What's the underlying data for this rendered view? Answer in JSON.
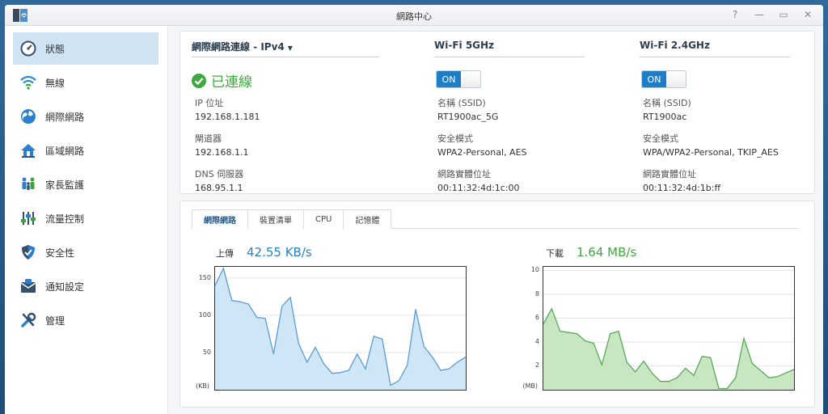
{
  "window": {
    "title": "網路中心",
    "controls": [
      "?",
      "—",
      "▭",
      "✕"
    ]
  },
  "sidebar": {
    "items": [
      {
        "label": "狀態",
        "icon": "gauge-icon"
      },
      {
        "label": "無線",
        "icon": "wifi-icon"
      },
      {
        "label": "網際網路",
        "icon": "globe-icon"
      },
      {
        "label": "區域網路",
        "icon": "home-network-icon"
      },
      {
        "label": "家長監護",
        "icon": "family-icon"
      },
      {
        "label": "流量控制",
        "icon": "sliders-icon"
      },
      {
        "label": "安全性",
        "icon": "shield-icon"
      },
      {
        "label": "通知設定",
        "icon": "notification-icon"
      },
      {
        "label": "管理",
        "icon": "tools-icon"
      }
    ],
    "active_index": 0
  },
  "internet": {
    "header": "網際網路連線 - IPv4",
    "status": "已連線",
    "ip_label": "IP 位址",
    "ip_value": "192.168.1.181",
    "gateway_label": "閘道器",
    "gateway_value": "192.168.1.1",
    "dns_label": "DNS 伺服器",
    "dns_value": "168.95.1.1"
  },
  "wifi5": {
    "header": "Wi-Fi 5GHz",
    "toggle": "ON",
    "ssid_label": "名稱 (SSID)",
    "ssid_value": "RT1900ac_5G",
    "security_label": "安全模式",
    "security_value": "WPA2-Personal, AES",
    "mac_label": "網路實體位址",
    "mac_value": "00:11:32:4d:1c:00"
  },
  "wifi24": {
    "header": "Wi-Fi 2.4GHz",
    "toggle": "ON",
    "ssid_label": "名稱 (SSID)",
    "ssid_value": "RT1900ac",
    "security_label": "安全模式",
    "security_value": "WPA/WPA2-Personal, TKIP_AES",
    "mac_label": "網路實體位址",
    "mac_value": "00:11:32:4d:1b:ff"
  },
  "tabs": [
    "網際網路",
    "裝置清單",
    "CPU",
    "記憶體"
  ],
  "upload": {
    "label": "上傳",
    "value": "42.55 KB/s",
    "color": "#2a80c4"
  },
  "download": {
    "label": "下載",
    "value": "1.64 MB/s",
    "color": "#3fa83f"
  },
  "chart_data": [
    {
      "type": "area",
      "name": "upload",
      "unit": "(KB)",
      "ylim": [
        0,
        165
      ],
      "yticks": [
        50,
        100,
        150
      ],
      "values": [
        140,
        163,
        120,
        118,
        115,
        97,
        96,
        48,
        112,
        124,
        62,
        37,
        57,
        35,
        22,
        23,
        26,
        48,
        28,
        72,
        68,
        6,
        12,
        33,
        108,
        58,
        44,
        26,
        28,
        37,
        44
      ],
      "line_color": "#5a9bd4",
      "fill_color": "#cfe6f7"
    },
    {
      "type": "area",
      "name": "download",
      "unit": "(MB)",
      "ylim": [
        0,
        10.3
      ],
      "yticks": [
        2,
        4,
        6,
        8,
        10
      ],
      "values": [
        5.5,
        6.8,
        4.9,
        4.8,
        4.7,
        4.1,
        3.9,
        2.1,
        4.7,
        4.9,
        2.3,
        1.5,
        2.4,
        1.4,
        0.7,
        0.7,
        1.0,
        1.8,
        1.2,
        2.8,
        2.7,
        0.1,
        0.1,
        1.0,
        4.3,
        2.2,
        1.6,
        1.0,
        1.1,
        1.4,
        1.7
      ],
      "line_color": "#57a957",
      "fill_color": "#c8e6c2"
    }
  ]
}
